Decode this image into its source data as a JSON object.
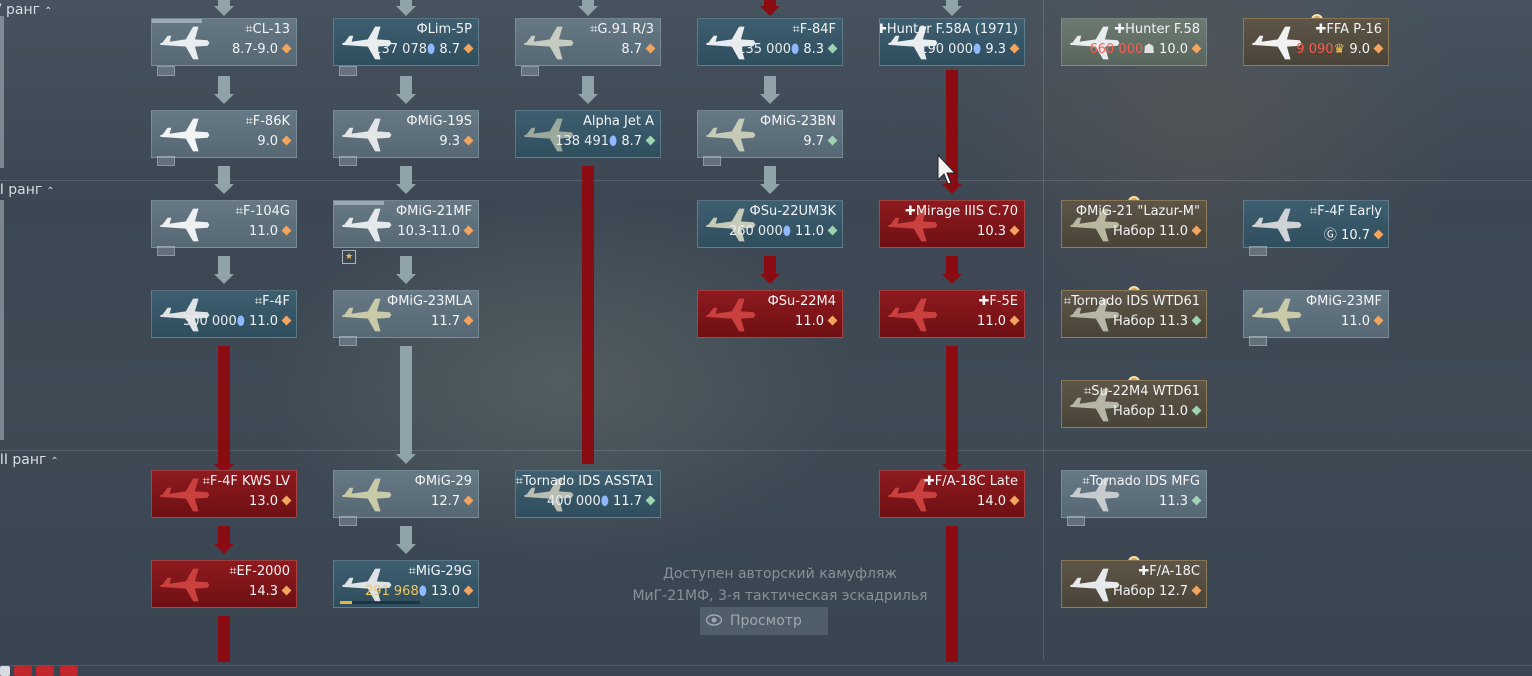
{
  "ranks": [
    {
      "label": "V ранг"
    },
    {
      "label": "VII ранг"
    },
    {
      "label": "VIII ранг"
    }
  ],
  "vehicles": [
    {
      "id": "cl13",
      "name": "⌗CL-13",
      "line2": "8.7-9.0",
      "diamond": "orange"
    },
    {
      "id": "lim5p",
      "name": "ФLim-5P",
      "rp": "137 078",
      "br": "8.7",
      "diamond": "orange"
    },
    {
      "id": "g91",
      "name": "⌗G.91 R/3",
      "br": "8.7",
      "diamond": "orange"
    },
    {
      "id": "f84f",
      "name": "⌗F-84F",
      "rp": "135 000",
      "br": "8.3",
      "diamond": "green"
    },
    {
      "id": "hunter58a",
      "name": "✚Hunter F.58A (1971)",
      "rp": "190 000",
      "br": "9.3",
      "diamond": "orange"
    },
    {
      "id": "hunter58",
      "name": "✚Hunter F.58",
      "cost": "660 000",
      "br": "10.0",
      "diamond": "orange"
    },
    {
      "id": "ffap16",
      "name": "✚FFA P-16",
      "cost": "9 090",
      "br": "9.0",
      "diamond": "orange"
    },
    {
      "id": "f86k",
      "name": "⌗F-86K",
      "br": "9.0",
      "diamond": "orange"
    },
    {
      "id": "mig19s",
      "name": "ФMiG-19S",
      "br": "9.3",
      "diamond": "orange"
    },
    {
      "id": "alphajet",
      "name": "Alpha Jet A",
      "rp": "138 491",
      "br": "8.7",
      "diamond": "green"
    },
    {
      "id": "mig23bn",
      "name": "ФMiG-23BN",
      "br": "9.7",
      "diamond": "green"
    },
    {
      "id": "f104g",
      "name": "⌗F-104G",
      "br": "11.0",
      "diamond": "orange"
    },
    {
      "id": "mig21mf",
      "name": "ФMiG-21MF",
      "line2": "10.3-11.0",
      "diamond": "orange"
    },
    {
      "id": "su22um3k",
      "name": "ФSu-22UM3K",
      "rp": "260 000",
      "br": "11.0",
      "diamond": "green"
    },
    {
      "id": "mirage",
      "name": "✚Mirage IIIS C.70",
      "br": "10.3",
      "diamond": "orange"
    },
    {
      "id": "mig21lazur",
      "name": "ФMiG-21 \"Lazur-M\"",
      "prefix": "Набор",
      "br": "11.0",
      "diamond": "orange"
    },
    {
      "id": "f4fearly",
      "name": "⌗F-4F Early",
      "prefix": "Ⓖ",
      "br": "10.7",
      "diamond": "orange"
    },
    {
      "id": "f4f",
      "name": "⌗F-4F",
      "rp": "300 000",
      "br": "11.0",
      "diamond": "orange"
    },
    {
      "id": "mig23mla",
      "name": "ФMiG-23MLA",
      "br": "11.7",
      "diamond": "orange"
    },
    {
      "id": "su22m4",
      "name": "ФSu-22M4",
      "br": "11.0",
      "diamond": "orange"
    },
    {
      "id": "f5e",
      "name": "✚F-5E",
      "br": "11.0",
      "diamond": "orange"
    },
    {
      "id": "tornadowtd",
      "name": "⌗Tornado IDS WTD61",
      "prefix": "Набор",
      "br": "11.3",
      "diamond": "green"
    },
    {
      "id": "mig23mf",
      "name": "ФMiG-23MF",
      "br": "11.0",
      "diamond": "orange"
    },
    {
      "id": "su22wtd",
      "name": "⌗Su-22M4 WTD61",
      "prefix": "Набор",
      "br": "11.0",
      "diamond": "green"
    },
    {
      "id": "f4fkws",
      "name": "⌗F-4F KWS LV",
      "br": "13.0",
      "diamond": "orange"
    },
    {
      "id": "mig29",
      "name": "ФMiG-29",
      "br": "12.7",
      "diamond": "orange"
    },
    {
      "id": "tornadoassta",
      "name": "⌗Tornado IDS ASSTA1",
      "rp": "400 000",
      "br": "11.7",
      "diamond": "green"
    },
    {
      "id": "fa18late",
      "name": "✚F/A-18C Late",
      "br": "14.0",
      "diamond": "orange"
    },
    {
      "id": "tornadomfg",
      "name": "⌗Tornado IDS MFG",
      "br": "11.3",
      "diamond": "green"
    },
    {
      "id": "ef2000",
      "name": "⌗EF-2000",
      "br": "14.3",
      "diamond": "orange"
    },
    {
      "id": "mig29g",
      "name": "⌗MiG-29G",
      "rp": "291 968",
      "br": "13.0",
      "diamond": "orange",
      "progress": 0.15
    },
    {
      "id": "fa18c",
      "name": "✚F/A-18C",
      "prefix": "Набор",
      "br": "12.7",
      "diamond": "orange"
    }
  ],
  "camo_notice": {
    "line1": "Доступен авторский камуфляж",
    "line2": "МиГ-21МФ, 3-я тактическая эскадрилья",
    "button": "Просмотр"
  }
}
